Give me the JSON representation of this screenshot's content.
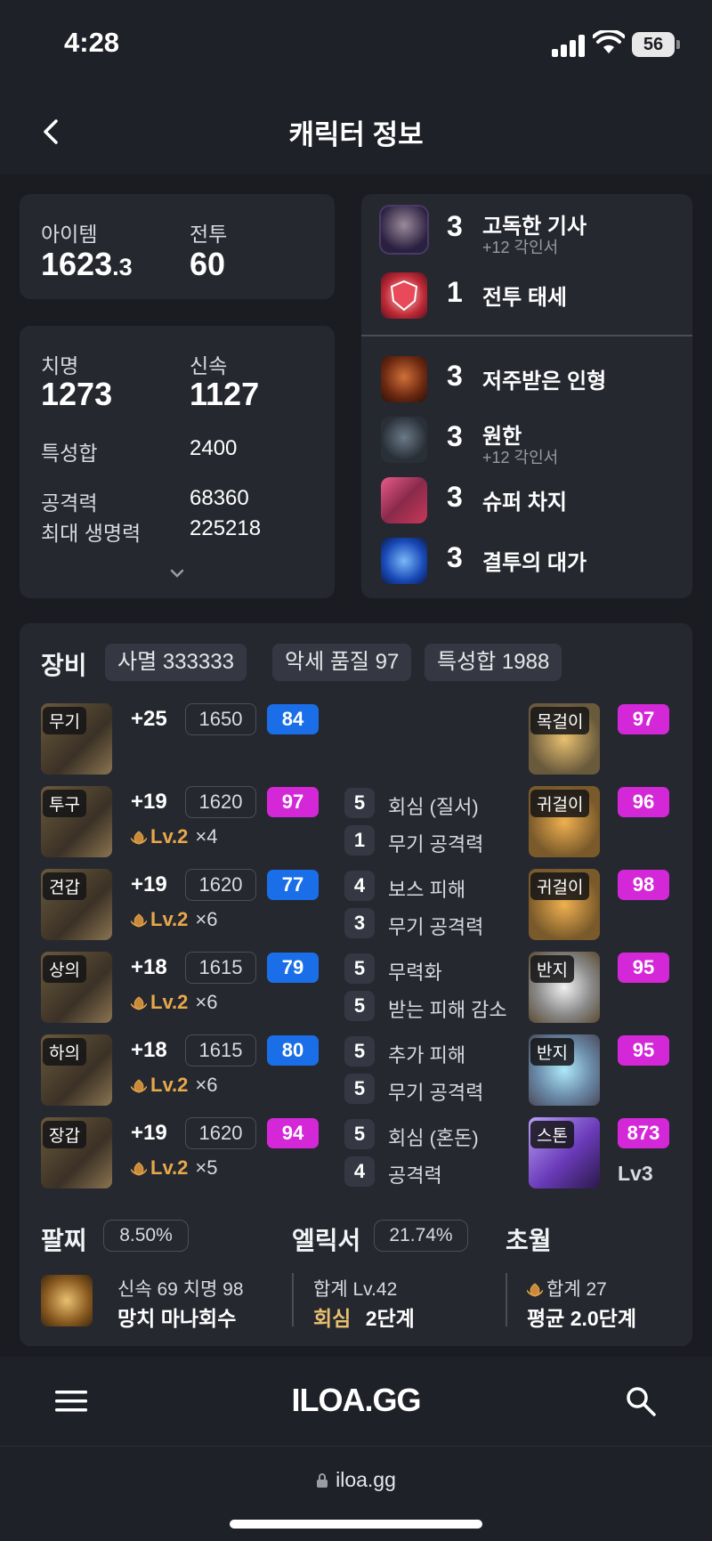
{
  "status": {
    "time": "4:28",
    "battery": "56"
  },
  "header": {
    "title": "캐릭터 정보"
  },
  "stats": {
    "item_label": "아이템",
    "item_value_main": "1623",
    "item_value_frac": ".3",
    "combat_label": "전투",
    "combat_value": "60",
    "crit_label": "치명",
    "crit_value": "1273",
    "swift_label": "신속",
    "swift_value": "1127",
    "trait_sum_label": "특성합",
    "trait_sum_value": "2400",
    "attack_label": "공격력",
    "attack_value": "68360",
    "hp_label": "최대 생명력",
    "hp_value": "225218"
  },
  "engravings": {
    "top": [
      {
        "level": "3",
        "name": "고독한 기사",
        "sub": "+12 각인서",
        "icon": "knight-portrait-icon"
      },
      {
        "level": "1",
        "name": "전투 태세",
        "sub": "",
        "icon": "shield-stance-icon"
      }
    ],
    "bottom": [
      {
        "level": "3",
        "name": "저주받은 인형",
        "sub": "",
        "icon": "cursed-doll-icon"
      },
      {
        "level": "3",
        "name": "원한",
        "sub": "+12 각인서",
        "icon": "grudge-beast-icon"
      },
      {
        "level": "3",
        "name": "슈퍼 차지",
        "sub": "",
        "icon": "super-charge-icon"
      },
      {
        "level": "3",
        "name": "결투의 대가",
        "sub": "",
        "icon": "duel-master-icon"
      }
    ]
  },
  "equipment": {
    "title": "장비",
    "chips": [
      "사멸 333333",
      "악세 품질 97",
      "특성합 1988"
    ],
    "gear": [
      {
        "tag": "무기",
        "enh": "+25",
        "ilvl": "1650",
        "quality": "84",
        "qcolor": "blue",
        "elix_lv": "",
        "elix_mul": ""
      },
      {
        "tag": "투구",
        "enh": "+19",
        "ilvl": "1620",
        "quality": "97",
        "qcolor": "pink",
        "elix_lv": "Lv.2",
        "elix_mul": "×4"
      },
      {
        "tag": "견갑",
        "enh": "+19",
        "ilvl": "1620",
        "quality": "77",
        "qcolor": "blue",
        "elix_lv": "Lv.2",
        "elix_mul": "×6"
      },
      {
        "tag": "상의",
        "enh": "+18",
        "ilvl": "1615",
        "quality": "79",
        "qcolor": "blue",
        "elix_lv": "Lv.2",
        "elix_mul": "×6"
      },
      {
        "tag": "하의",
        "enh": "+18",
        "ilvl": "1615",
        "quality": "80",
        "qcolor": "blue",
        "elix_lv": "Lv.2",
        "elix_mul": "×6"
      },
      {
        "tag": "장갑",
        "enh": "+19",
        "ilvl": "1620",
        "quality": "94",
        "qcolor": "pink",
        "elix_lv": "Lv.2",
        "elix_mul": "×5"
      }
    ],
    "options": [
      [
        {
          "n": "5",
          "t": "회심 (질서)"
        },
        {
          "n": "1",
          "t": "무기 공격력"
        }
      ],
      [
        {
          "n": "4",
          "t": "보스 피해"
        },
        {
          "n": "3",
          "t": "무기 공격력"
        }
      ],
      [
        {
          "n": "5",
          "t": "무력화"
        },
        {
          "n": "5",
          "t": "받는 피해 감소"
        }
      ],
      [
        {
          "n": "5",
          "t": "추가 피해"
        },
        {
          "n": "5",
          "t": "무기 공격력"
        }
      ],
      [
        {
          "n": "5",
          "t": "회심 (혼돈)"
        },
        {
          "n": "4",
          "t": "공격력"
        }
      ]
    ],
    "accessories": [
      {
        "tag": "목걸이",
        "quality": "97"
      },
      {
        "tag": "귀걸이",
        "quality": "96"
      },
      {
        "tag": "귀걸이",
        "quality": "98"
      },
      {
        "tag": "반지",
        "quality": "95"
      },
      {
        "tag": "반지",
        "quality": "95"
      },
      {
        "tag": "스톤",
        "quality": "873",
        "extra": "Lv3"
      }
    ]
  },
  "bracelet": {
    "label": "팔찌",
    "pct": "8.50%",
    "line1": "신속 69  치명 98",
    "line2": "망치  마나회수"
  },
  "elixir": {
    "label": "엘릭서",
    "pct": "21.74%",
    "line1": "합계 Lv.42",
    "line2_hl": "회심",
    "line2": "2단계"
  },
  "transcend": {
    "label": "초월",
    "line1": "합계 27",
    "line2": "평균 2.0단계"
  },
  "nav": {
    "logo": "ILOA.GG"
  },
  "url": {
    "text": "iloa.gg"
  }
}
